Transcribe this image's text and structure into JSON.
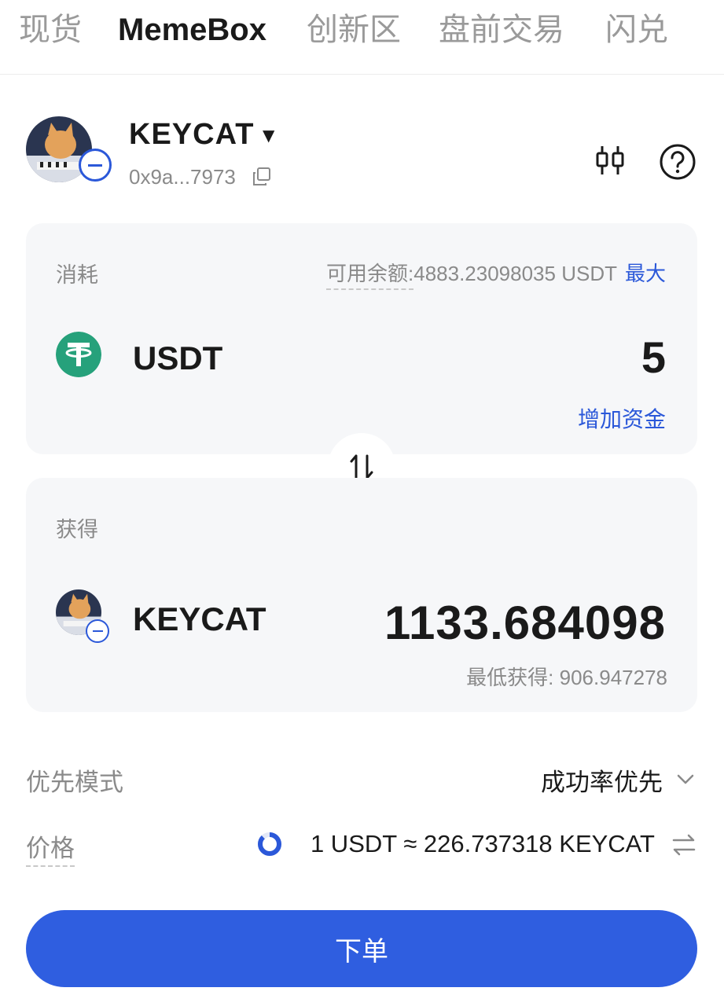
{
  "tabs": [
    {
      "label": "现货"
    },
    {
      "label": "MemeBox"
    },
    {
      "label": "创新区"
    },
    {
      "label": "盘前交易"
    },
    {
      "label": "闪兑"
    }
  ],
  "token": {
    "name": "KEYCAT",
    "address": "0x9a...7973"
  },
  "pay": {
    "label": "消耗",
    "balance_label": "可用余额:",
    "balance_value": "4883.23098035 USDT",
    "max_label": "最大",
    "coin": "USDT",
    "amount": "5",
    "add_funds": "增加资金"
  },
  "receive": {
    "label": "获得",
    "coin": "KEYCAT",
    "amount": "1133.684098",
    "min_label": "最低获得: ",
    "min_value": "906.947278"
  },
  "settings": {
    "mode_label": "优先模式",
    "mode_value": "成功率优先",
    "price_label": "价格",
    "price_value": "1 USDT ≈ 226.737318 KEYCAT"
  },
  "submit_label": "下单",
  "colors": {
    "accent": "#2b58d9",
    "button": "#2f5ee0",
    "usdt": "#26a17b",
    "card_bg": "#f6f7f9"
  }
}
